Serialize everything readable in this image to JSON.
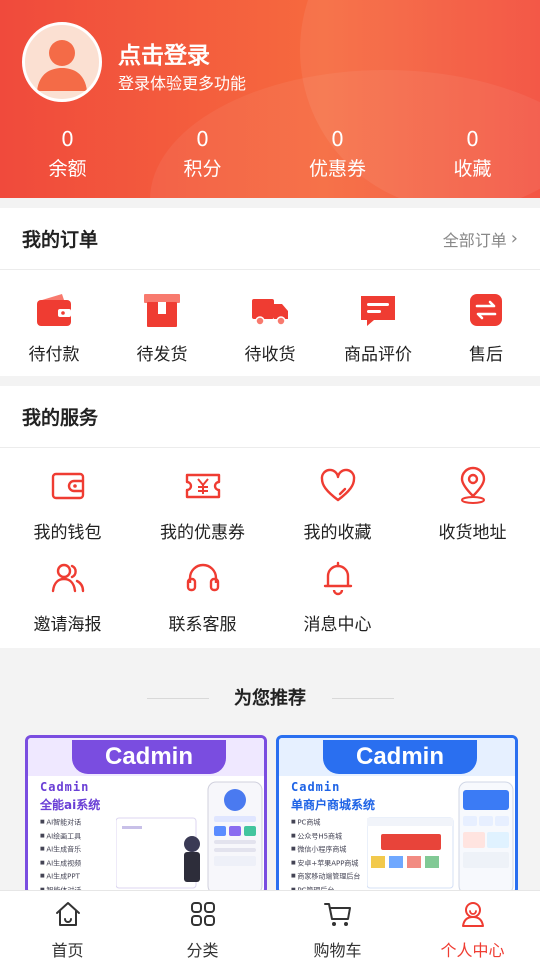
{
  "header": {
    "title": "点击登录",
    "subtitle": "登录体验更多功能",
    "stats": [
      {
        "value": "0",
        "label": "余额"
      },
      {
        "value": "0",
        "label": "积分"
      },
      {
        "value": "0",
        "label": "优惠券"
      },
      {
        "value": "0",
        "label": "收藏"
      }
    ]
  },
  "orders": {
    "title": "我的订单",
    "more": "全部订单",
    "items": [
      {
        "label": "待付款",
        "icon": "wallet-icon"
      },
      {
        "label": "待发货",
        "icon": "box-icon"
      },
      {
        "label": "待收货",
        "icon": "truck-icon"
      },
      {
        "label": "商品评价",
        "icon": "comment-icon"
      },
      {
        "label": "售后",
        "icon": "exchange-icon"
      }
    ]
  },
  "services": {
    "title": "我的服务",
    "items": [
      {
        "label": "我的钱包",
        "icon": "wallet-outline-icon"
      },
      {
        "label": "我的优惠券",
        "icon": "coupon-icon"
      },
      {
        "label": "我的收藏",
        "icon": "heart-icon"
      },
      {
        "label": "收货地址",
        "icon": "location-icon"
      },
      {
        "label": "邀请海报",
        "icon": "users-icon"
      },
      {
        "label": "联系客服",
        "icon": "headset-icon"
      },
      {
        "label": "消息中心",
        "icon": "bell-icon"
      }
    ]
  },
  "recommend": {
    "title": "为您推荐",
    "cards": [
      {
        "badge": "Cadmin",
        "name": "Cadmin",
        "subtitle": "全能ai系统",
        "features": [
          "AI智能对话",
          "AI绘画工具",
          "AI生成音乐",
          "AI生成视频",
          "AI生成PPT",
          "智能体对话"
        ],
        "color": "#7a4de0"
      },
      {
        "badge": "Cadmin",
        "name": "Cadmin",
        "subtitle": "单商户商城系统",
        "features": [
          "PC商城",
          "公众号H5商城",
          "微信小程序商城",
          "安卓+苹果APP商城",
          "商家移动端管理后台",
          "PC管理后台"
        ],
        "color": "#2a6ff0"
      }
    ]
  },
  "tabbar": {
    "items": [
      {
        "label": "首页",
        "icon": "home-icon",
        "active": false
      },
      {
        "label": "分类",
        "icon": "grid-icon",
        "active": false
      },
      {
        "label": "购物车",
        "icon": "cart-icon",
        "active": false
      },
      {
        "label": "个人中心",
        "icon": "profile-icon",
        "active": true
      }
    ]
  },
  "colors": {
    "accent": "#ef3c32",
    "header_start": "#f04a3c",
    "header_end": "#f66a3e"
  }
}
